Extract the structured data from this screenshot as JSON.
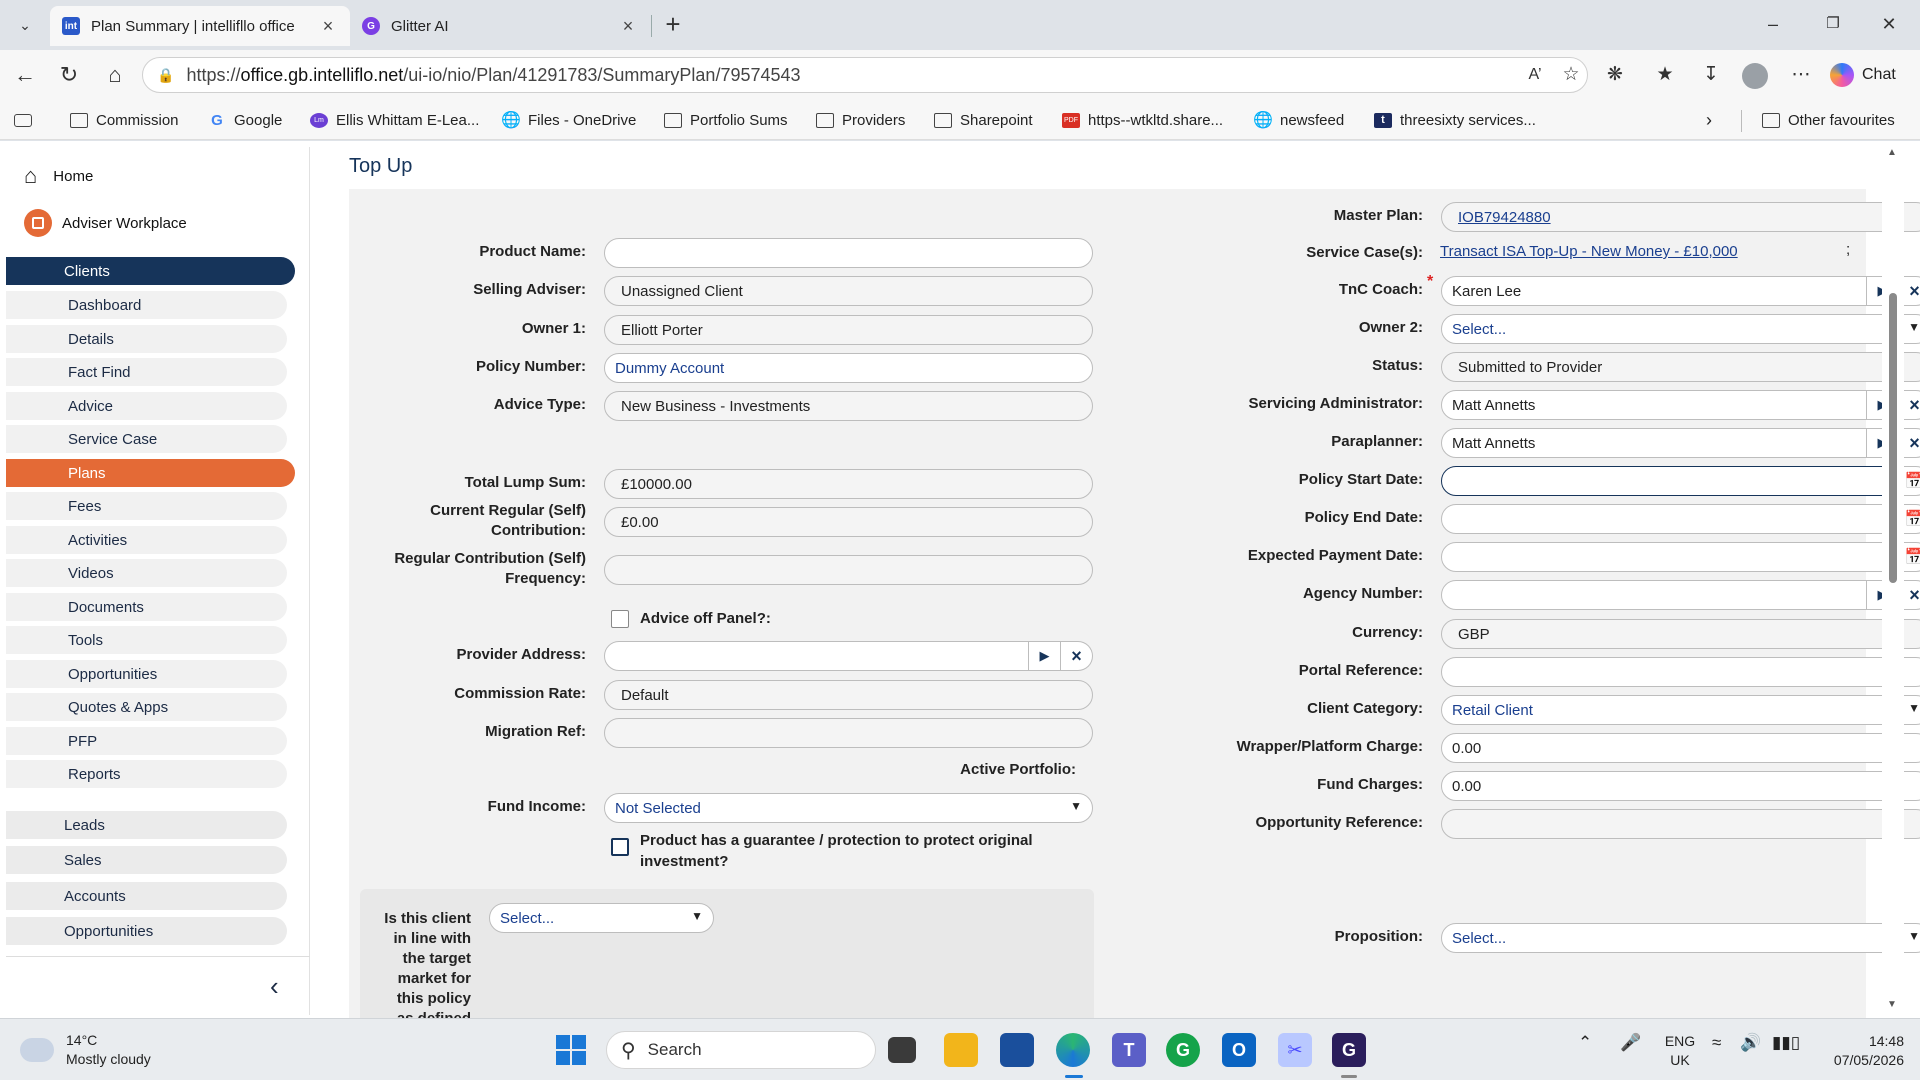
{
  "browser": {
    "tabs": [
      {
        "title": "Plan Summary | intellifllo office",
        "favicon": "int"
      },
      {
        "title": "Glitter AI",
        "favicon": "G"
      }
    ],
    "url": "https://office.gb.intelliflo.net/ui-io/nio/Plan/41291783/SummaryPlan/79574543",
    "url_prefix": "https://",
    "url_domain": "office.gb.intelliflo.net",
    "url_path": "/ui-io/nio/Plan/41291783/SummaryPlan/79574543",
    "chat_label": "Chat",
    "bookmarks": [
      {
        "label": "Commission",
        "icon": "folder-icon"
      },
      {
        "label": "Google",
        "icon": "google-icon"
      },
      {
        "label": "Ellis Whittam E-Lea...",
        "icon": "ellis-icon"
      },
      {
        "label": "Files - OneDrive",
        "icon": "globe-icon"
      },
      {
        "label": "Portfolio Sums",
        "icon": "folder-icon"
      },
      {
        "label": "Providers",
        "icon": "folder-icon"
      },
      {
        "label": "Sharepoint",
        "icon": "folder-icon"
      },
      {
        "label": "https--wtkltd.share...",
        "icon": "pdf-icon"
      },
      {
        "label": "newsfeed",
        "icon": "globe-icon"
      },
      {
        "label": "threesixty services...",
        "icon": "t-icon"
      }
    ],
    "other_favourites": "Other favourites"
  },
  "sidebar": {
    "home": "Home",
    "workplace": "Adviser Workplace",
    "clients": "Clients",
    "sub_items": [
      "Dashboard",
      "Details",
      "Fact Find",
      "Advice",
      "Service Case",
      "Plans",
      "Fees",
      "Activities",
      "Videos",
      "Documents",
      "Tools",
      "Opportunities",
      "Quotes & Apps",
      "PFP",
      "Reports"
    ],
    "active_item": "Plans",
    "main_items": [
      "Leads",
      "Sales",
      "Accounts",
      "Opportunities"
    ]
  },
  "page": {
    "title": "Top Up"
  },
  "form_left": {
    "product_name": {
      "label": "Product Name:",
      "value": ""
    },
    "selling_adviser": {
      "label": "Selling Adviser:",
      "value": "Unassigned Client"
    },
    "owner1": {
      "label": "Owner 1:",
      "value": "Elliott Porter"
    },
    "policy_number": {
      "label": "Policy Number:",
      "value": "Dummy Account"
    },
    "advice_type": {
      "label": "Advice Type:",
      "value": "New Business - Investments"
    },
    "total_lump_sum": {
      "label": "Total Lump Sum:",
      "value": "£10000.00"
    },
    "current_regular_line1": "Current Regular (Self)",
    "current_regular_line2": "Contribution:",
    "current_regular_value": "£0.00",
    "regular_freq_line1": "Regular Contribution (Self)",
    "regular_freq_line2": "Frequency:",
    "regular_freq_value": "",
    "advice_off_panel": "Advice off Panel?:",
    "provider_address": {
      "label": "Provider Address:",
      "value": ""
    },
    "commission_rate": {
      "label": "Commission Rate:",
      "value": "Default"
    },
    "migration_ref": {
      "label": "Migration Ref:",
      "value": ""
    },
    "active_portfolio": "Active Portfolio:",
    "fund_income": {
      "label": "Fund Income:",
      "value": "Not Selected"
    },
    "guarantee_line1": "Product has a guarantee / protection to protect original",
    "guarantee_line2": "investment?",
    "target_market_lines": [
      "Is this client",
      "in line with",
      "the target",
      "market for",
      "this policy",
      "as defined"
    ],
    "target_market_value": "Select..."
  },
  "form_right": {
    "master_plan": {
      "label": "Master Plan:",
      "value": "IOB79424880"
    },
    "service_cases": {
      "label": "Service Case(s):",
      "value": "Transact ISA Top-Up - New Money - £10,000",
      "extra": ";"
    },
    "tnc_coach": {
      "label": "TnC Coach:",
      "value": "Karen Lee",
      "required": "*"
    },
    "owner2": {
      "label": "Owner 2:",
      "value": "Select..."
    },
    "status": {
      "label": "Status:",
      "value": "Submitted to Provider"
    },
    "servicing_admin": {
      "label": "Servicing Administrator:",
      "value": "Matt Annetts"
    },
    "paraplanner": {
      "label": "Paraplanner:",
      "value": "Matt Annetts"
    },
    "policy_start": {
      "label": "Policy Start Date:",
      "value": ""
    },
    "policy_end": {
      "label": "Policy End Date:",
      "value": ""
    },
    "expected_payment": {
      "label": "Expected Payment Date:",
      "value": ""
    },
    "agency_number": {
      "label": "Agency Number:",
      "value": ""
    },
    "currency": {
      "label": "Currency:",
      "value": "GBP"
    },
    "portal_reference": {
      "label": "Portal Reference:",
      "value": ""
    },
    "client_category": {
      "label": "Client Category:",
      "value": "Retail Client"
    },
    "wrapper_charge": {
      "label": "Wrapper/Platform Charge:",
      "value": "0.00"
    },
    "fund_charges": {
      "label": "Fund Charges:",
      "value": "0.00"
    },
    "opportunity_reference": {
      "label": "Opportunity Reference:",
      "value": ""
    },
    "proposition": {
      "label": "Proposition:",
      "value": "Select..."
    }
  },
  "taskbar": {
    "temperature": "14°C",
    "weather": "Mostly cloudy",
    "search_placeholder": "Search",
    "language": "ENG",
    "region": "UK",
    "time": "14:48",
    "date": "07/05/2026"
  },
  "colors": {
    "nav_dark": "#16345a",
    "nav_active": "#e46a36",
    "link": "#1a3f8f",
    "panel": "#f2f2f2"
  }
}
